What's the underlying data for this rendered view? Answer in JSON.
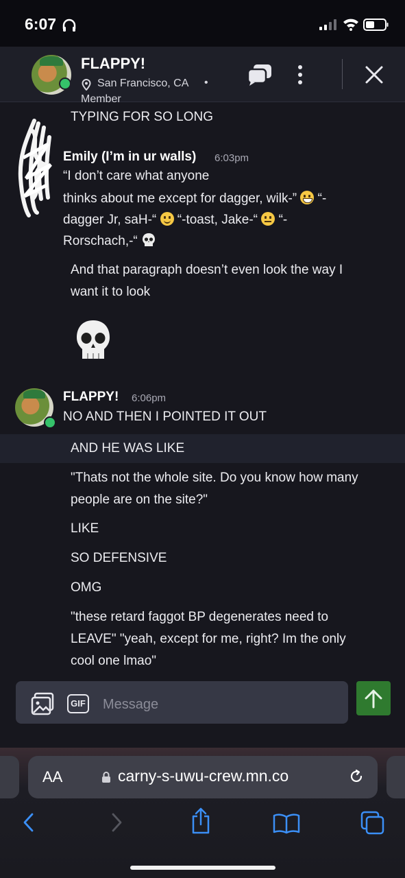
{
  "status_bar": {
    "time": "6:07"
  },
  "header": {
    "name": "FLAPPY!",
    "location": "San Francisco, CA",
    "separator": "•",
    "role": "Member"
  },
  "messages": {
    "prev_tail": "TYPING FOR SO LONG",
    "emily": {
      "sender": "Emily (I’m in ur walls)",
      "time": "6:03pm",
      "line1": "“I don’t care what anyone",
      "line2a": "thinks about me except for dagger, wilk-”",
      "line2b": "“-",
      "line3a": "dagger Jr, saH-“",
      "line3b": "“-toast, Jake-“",
      "line3c": "“-",
      "line4": "Rorschach,-“",
      "para_line1": "And that paragraph doesn’t even look the way I",
      "para_line2": "want it to look"
    },
    "flappy": {
      "sender": "FLAPPY!",
      "time": "6:06pm",
      "lines": [
        "NO AND THEN I POINTED IT OUT",
        "AND HE WAS LIKE",
        "\"Thats not the whole site. Do you know how many",
        "people are on the site?\"",
        "LIKE",
        "SO DEFENSIVE",
        "OMG",
        "\"these retard faggot BP degenerates need to",
        "LEAVE\" \"yeah, except for me, right? Im the only",
        "cool one lmao\""
      ]
    }
  },
  "composer": {
    "gif_label": "GIF",
    "placeholder": "Message"
  },
  "browser": {
    "text_size_label": "AA",
    "url": "carny-s-uwu-crew.mn.co"
  },
  "colors": {
    "send": "#2f7a2f",
    "online": "#35c26a",
    "background": "#17171e"
  }
}
